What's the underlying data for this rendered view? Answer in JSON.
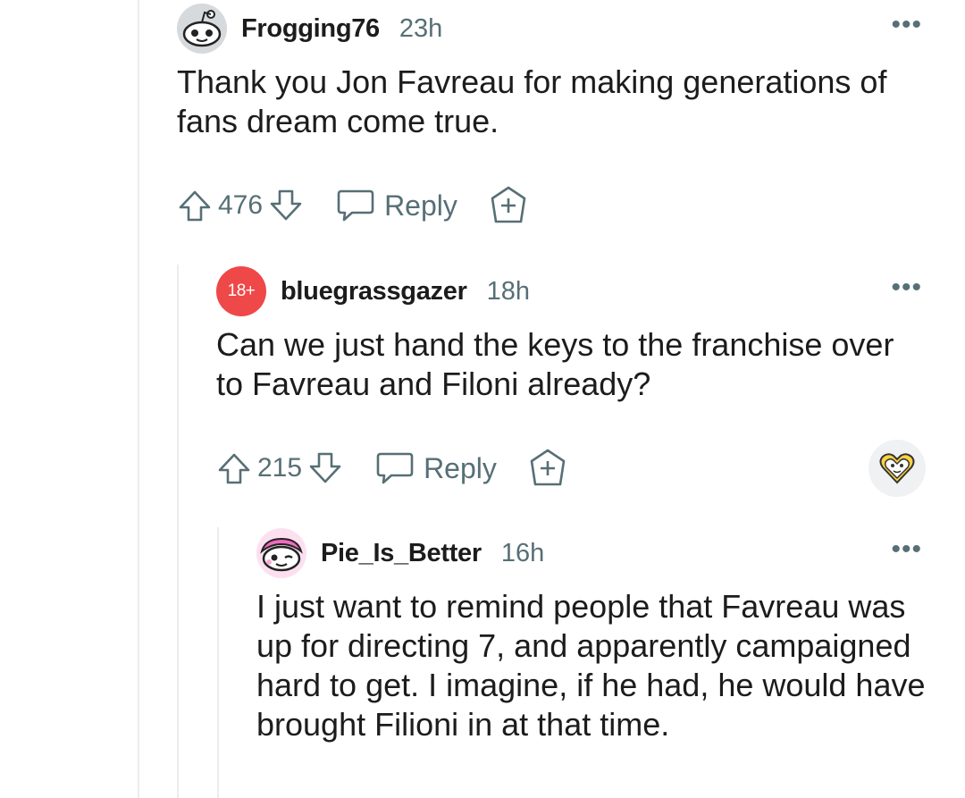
{
  "comments": [
    {
      "avatar": "snoo-avatar-icon",
      "username": "Frogging76",
      "timestamp": "23h",
      "more": "•••",
      "body": "Thank you Jon Favreau for making generations of fans dream come true.",
      "votes": "476",
      "reply_label": "Reply"
    },
    {
      "avatar_badge": "18+",
      "username": "bluegrassgazer",
      "timestamp": "18h",
      "more": "•••",
      "body": "Can we just hand the keys to the franchise over to Favreau and Filoni already?",
      "votes": "215",
      "reply_label": "Reply",
      "award": "heart-award-icon"
    },
    {
      "avatar": "snoo-avatar-pink-icon",
      "username": "Pie_Is_Better",
      "timestamp": "16h",
      "more": "•••",
      "body": "I just want to remind people that Favreau was up for directing 7, and apparently campaigned hard to get. I imagine, if he had, he would have brought Filioni in at that time."
    }
  ],
  "colors": {
    "meta_gray": "#576f76",
    "nsfw_red": "#ef4848",
    "thread_line": "#ececec",
    "pink_avatar": "#f06ac0"
  }
}
